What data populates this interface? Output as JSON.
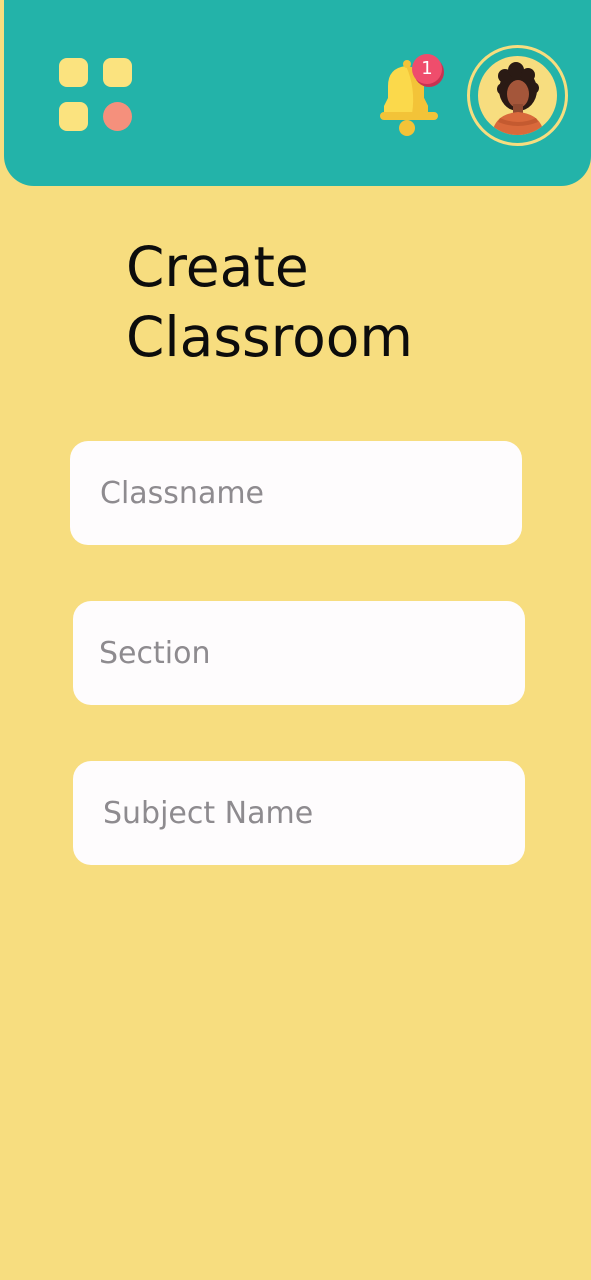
{
  "header": {
    "menu_icon": "grid-menu-icon",
    "notifications": {
      "icon": "bell-icon",
      "count": "1"
    },
    "profile": {
      "icon": "avatar"
    }
  },
  "page": {
    "title_line1": "Create",
    "title_line2": "Classroom"
  },
  "form": {
    "classname": {
      "placeholder": "Classname",
      "value": ""
    },
    "section": {
      "placeholder": "Section",
      "value": ""
    },
    "subject_name": {
      "placeholder": "Subject Name",
      "value": ""
    }
  },
  "colors": {
    "background": "#f7dd7f",
    "header": "#23b3a9",
    "badge": "#ef4d6c",
    "bell": "#fbd94b",
    "input_background": "#fefcfd",
    "placeholder": "#8e8b8f"
  }
}
